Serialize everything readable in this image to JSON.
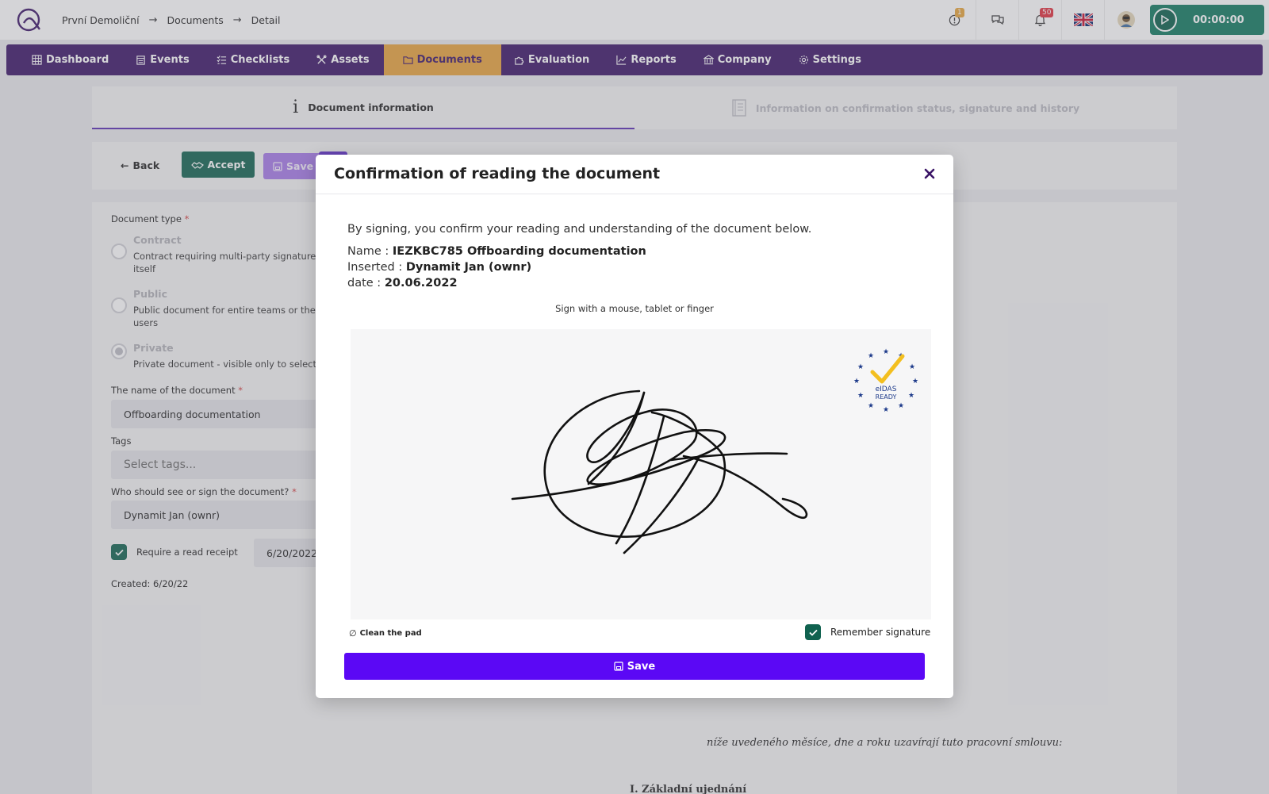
{
  "breadcrumb": {
    "company": "První Demoliční",
    "section": "Documents",
    "page": "Detail"
  },
  "topbar": {
    "alert_count": "1",
    "notification_count": "50",
    "timer": "00:00:00"
  },
  "nav": {
    "items": [
      {
        "label": "Dashboard",
        "icon": "grid-icon"
      },
      {
        "label": "Events",
        "icon": "calendar-icon"
      },
      {
        "label": "Checklists",
        "icon": "checklist-icon"
      },
      {
        "label": "Assets",
        "icon": "tools-icon"
      },
      {
        "label": "Documents",
        "icon": "folder-icon"
      },
      {
        "label": "Evaluation",
        "icon": "puzzle-icon"
      },
      {
        "label": "Reports",
        "icon": "chart-icon"
      },
      {
        "label": "Company",
        "icon": "building-icon"
      },
      {
        "label": "Settings",
        "icon": "gear-icon"
      }
    ],
    "active": "Documents"
  },
  "tabs": {
    "info": "Document information",
    "status": "Information on confirmation status, signature and history"
  },
  "actions": {
    "back": "Back",
    "accept": "Accept",
    "save": "Save"
  },
  "form": {
    "doc_type_label": "Document type",
    "options": [
      {
        "title": "Contract",
        "desc": "Contract requiring multi-party signatures itself"
      },
      {
        "title": "Public",
        "desc": "Public document for entire teams or the users"
      },
      {
        "title": "Private",
        "desc": "Private document - visible only to selecte"
      }
    ],
    "name_label": "The name of the document",
    "name_value": "Offboarding documentation",
    "tags_label": "Tags",
    "tags_placeholder": "Select tags...",
    "who_label": "Who should see or sign the document?",
    "who_value": "Dynamit Jan (ownr)",
    "read_receipt_label": "Require a read receipt",
    "read_receipt_date": "6/20/2022",
    "created": "Created: 6/20/22"
  },
  "document_preview": {
    "line1": "níže uvedeného měsíce, dne a roku uzavírají tuto pracovní smlouvu:",
    "line2": "I. Základní ujednání"
  },
  "modal": {
    "title": "Confirmation of reading the document",
    "intro": "By signing, you confirm your reading and understanding of the document below.",
    "name_label": "Name :",
    "name_value": "IEZKBC785 Offboarding documentation",
    "inserted_label": "Inserted :",
    "inserted_value": "Dynamit Jan (ownr)",
    "date_label": "date :",
    "date_value": "20.06.2022",
    "sign_hint": "Sign with a mouse, tablet or finger",
    "eidas_line1": "eIDAS",
    "eidas_line2": "READY",
    "clean_label": "Clean the pad",
    "remember_label": "Remember signature",
    "save_label": "Save"
  },
  "colors": {
    "nav_bg": "#3a1466",
    "nav_active": "#e8a23b",
    "accept": "#10624f",
    "primary": "#5b08f5",
    "timer": "#0f7a5f"
  }
}
